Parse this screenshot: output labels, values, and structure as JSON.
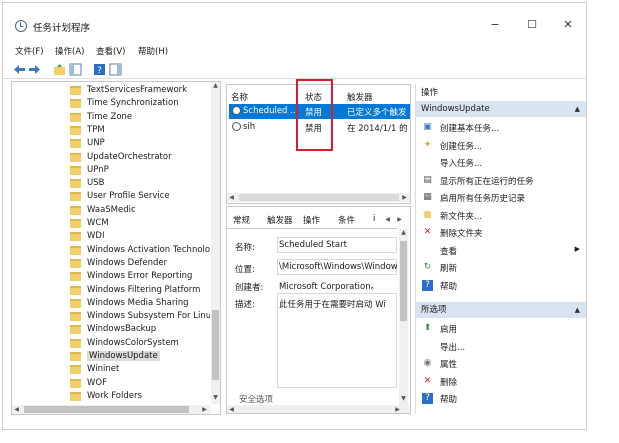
{
  "window": {
    "title": "任务计划程序",
    "controls": [
      "−",
      "☐",
      "✕"
    ]
  },
  "menu": [
    "文件(F)",
    "操作(A)",
    "查看(V)",
    "帮助(H)"
  ],
  "tree": {
    "items": [
      {
        "label": "TextServicesFramework"
      },
      {
        "label": "Time Synchronization"
      },
      {
        "label": "Time Zone"
      },
      {
        "label": "TPM"
      },
      {
        "label": "UNP"
      },
      {
        "label": "UpdateOrchestrator"
      },
      {
        "label": "UPnP"
      },
      {
        "label": "USB"
      },
      {
        "label": "User Profile Service"
      },
      {
        "label": "WaaSMedic"
      },
      {
        "label": "WCM"
      },
      {
        "label": "WDI"
      },
      {
        "label": "Windows Activation Technolo"
      },
      {
        "label": "Windows Defender"
      },
      {
        "label": "Windows Error Reporting"
      },
      {
        "label": "Windows Filtering Platform"
      },
      {
        "label": "Windows Media Sharing"
      },
      {
        "label": "Windows Subsystem For Linux"
      },
      {
        "label": "WindowsBackup"
      },
      {
        "label": "WindowsColorSystem"
      },
      {
        "label": "WindowsUpdate",
        "selected": true
      },
      {
        "label": "Wininet"
      },
      {
        "label": "WOF"
      },
      {
        "label": "Work Folders"
      }
    ]
  },
  "task_list": {
    "columns": [
      "名称",
      "状态",
      "触发器"
    ],
    "rows": [
      {
        "name": "Scheduled ...",
        "status": "禁用",
        "trigger": "已定义多个触发",
        "selected": true
      },
      {
        "name": "sih",
        "status": "禁用",
        "trigger": "在 2014/1/1 的"
      }
    ]
  },
  "details": {
    "tabs": [
      "常规",
      "触发器",
      "操作",
      "条件",
      "i"
    ],
    "fields": {
      "name_label": "名称:",
      "name_value": "Scheduled Start",
      "location_label": "位置:",
      "location_value": "\\Microsoft\\Windows\\Window",
      "author_label": "创建者:",
      "author_value": "Microsoft Corporation。",
      "desc_label": "描述:",
      "desc_value": "此任务用于在需要时启动 Wi",
      "security_label": "安全选项"
    }
  },
  "actions": {
    "header": "操作",
    "section1": "WindowsUpdate",
    "items1": [
      {
        "label": "创建基本任务...",
        "icon": "basic-task-icon"
      },
      {
        "label": "创建任务...",
        "icon": "create-task-icon"
      },
      {
        "label": "导入任务...",
        "icon": "none"
      },
      {
        "label": "显示所有正在运行的任务",
        "icon": "running-tasks-icon"
      },
      {
        "label": "启用所有任务历史记录",
        "icon": "history-icon"
      },
      {
        "label": "新文件夹...",
        "icon": "folder-icon"
      },
      {
        "label": "删除文件夹",
        "icon": "delete-icon"
      },
      {
        "label": "查看",
        "icon": "none",
        "submenu": true
      },
      {
        "label": "刷新",
        "icon": "refresh-icon"
      },
      {
        "label": "帮助",
        "icon": "help-icon"
      }
    ],
    "section2": "所选项",
    "items2": [
      {
        "label": "启用",
        "icon": "enable-icon"
      },
      {
        "label": "导出...",
        "icon": "none"
      },
      {
        "label": "属性",
        "icon": "properties-icon"
      },
      {
        "label": "删除",
        "icon": "delete-icon"
      },
      {
        "label": "帮助",
        "icon": "help-icon"
      }
    ]
  },
  "colors": {
    "selection": "#0078d7",
    "highlight_box": "#d71f2a",
    "section_bar": "#d9e4f1",
    "folder": "#f2cf6d"
  }
}
